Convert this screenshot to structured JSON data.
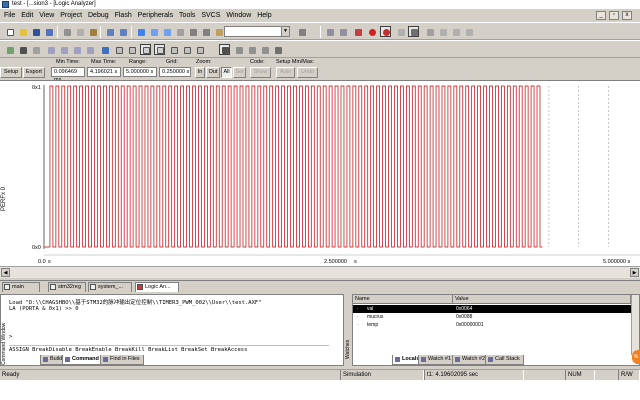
{
  "window": {
    "title": "test - [...sion3 - [Logic Analyzer]",
    "controls": [
      "_",
      "▫",
      "x"
    ]
  },
  "menu": [
    "File",
    "Edit",
    "View",
    "Project",
    "Debug",
    "Flash",
    "Peripherals",
    "Tools",
    "SVCS",
    "Window",
    "Help"
  ],
  "la": {
    "setup_label": "Setup",
    "export_label": "Export",
    "min_time_label": "Min Time:",
    "min_time_value": "0.096469 ms",
    "max_time_label": "Max Time:",
    "max_time_value": "4.196021 s",
    "range_label": "Range:",
    "range_value": "5.000000 s",
    "grid_label": "Grid:",
    "grid_value": "0.250000 s",
    "zoom_label": "Zoom:",
    "zoom_in": "In",
    "zoom_out": "Out",
    "zoom_all": "All",
    "zoom_sel": "Sel",
    "code_label": "Code:",
    "code_show": "Show",
    "setup_minmax_label": "Setup Min/Max:",
    "auto": "Auto",
    "undo": "Undo"
  },
  "plot": {
    "signal": "PERFx 0",
    "y_top": "0x1",
    "y_bottom": "0x0",
    "x_ticks": [
      "0.0",
      "s",
      "2.500000",
      "s",
      "5.000000 s"
    ]
  },
  "chart_data": {
    "type": "line",
    "title": "",
    "signal": "PERFx 0",
    "xlabel": "",
    "ylabel": "",
    "xlim": [
      0,
      5
    ],
    "ylim": [
      0,
      1
    ],
    "y_ticks": [
      "0x0",
      "0x1"
    ],
    "x_tick_values": [
      0,
      2.5,
      5
    ],
    "waveform": "square",
    "low": 0,
    "high": 1,
    "start_s": 0.05,
    "end_s": 4.196,
    "period_s": 0.05,
    "duty": 0.5,
    "grid": true,
    "grid_step_s": 0.25
  },
  "editor_tabs": [
    {
      "label": "main"
    },
    {
      "label": "stm32reg"
    },
    {
      "label": "system_..."
    },
    {
      "label": "Logic An..."
    }
  ],
  "cmd": {
    "side_label": "Command Window",
    "line1": "Load \"D:\\\\CHAGSHBO\\\\基于STM32的脉冲输出定位控制\\\\TIMER3_PWM_002\\\\User\\\\test.AXF\"",
    "line2": "LA (PORTA & 0x1) >> 0",
    "prompt": ">",
    "input": "ASSIGN BreakDisable BreakEnable BreakKill BreakList BreakSet BreakAccess",
    "tabs": [
      "Build",
      "Command",
      "Find in Files"
    ]
  },
  "watch": {
    "side_label": "Watches",
    "col_name": "Name",
    "col_value": "Value",
    "rows": [
      {
        "name": "val",
        "value": "0x0064"
      },
      {
        "name": "mucrus",
        "value": "0x0088"
      },
      {
        "name": "temp",
        "value": "0x00000001"
      }
    ],
    "tabs": [
      "Locals",
      "Watch #1",
      "Watch #2",
      "Call Stack"
    ]
  },
  "status": {
    "left": "Ready",
    "mode": "Simulation",
    "time": "t1: 4.19602095 sec",
    "num": "NUM",
    "rw": "R/W"
  },
  "colors": {
    "waveform": "#c00000",
    "grid_dash": "#a0a0a0",
    "selected_row": "#000000"
  }
}
